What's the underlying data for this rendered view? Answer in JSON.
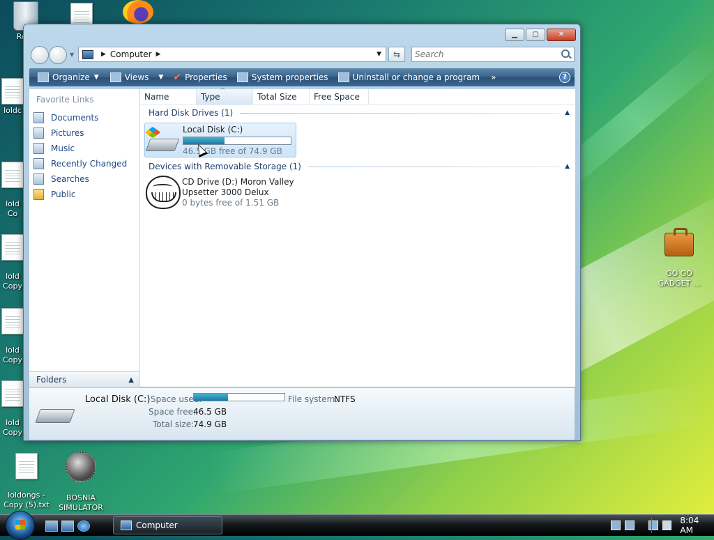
{
  "desktop": {
    "icons": [
      {
        "label": "Recy",
        "icon": "recycle-bin-icon"
      },
      {
        "label": "loldc",
        "icon": "text-file-icon"
      },
      {
        "label": "lold\nCo",
        "icon": "text-file-icon"
      },
      {
        "label": "lold\nCopy",
        "icon": "text-file-icon"
      },
      {
        "label": "lold\nCopy",
        "icon": "text-file-icon"
      },
      {
        "label": "lold\nCopy",
        "icon": "text-file-icon"
      },
      {
        "label": "loldongs -\nCopy (5).txt",
        "icon": "text-file-icon"
      },
      {
        "label": "BOSNIA\nSIMULATOR",
        "icon": "naval-mine-icon"
      },
      {
        "label": "GO GO\nGADGET ...",
        "icon": "briefcase-icon"
      }
    ]
  },
  "window": {
    "address": {
      "location": "Computer"
    },
    "search": {
      "placeholder": "Search"
    },
    "toolbar": {
      "organize": "Organize",
      "views": "Views",
      "properties": "Properties",
      "system_properties": "System properties",
      "uninstall": "Uninstall or change a program",
      "more": "»"
    },
    "sidebar": {
      "title": "Favorite Links",
      "items": [
        "Documents",
        "Pictures",
        "Music",
        "Recently Changed",
        "Searches",
        "Public"
      ],
      "folders_label": "Folders"
    },
    "columns": [
      "Name",
      "Type",
      "Total Size",
      "Free Space"
    ],
    "groups": [
      {
        "title": "Hard Disk Drives (1)",
        "items": [
          {
            "name": "Local Disk (C:)",
            "free_text": "46.5 GB free of 74.9 GB",
            "used_fraction": 0.38
          }
        ]
      },
      {
        "title": "Devices with Removable Storage (1)",
        "items": [
          {
            "name_line1": "CD Drive (D:) Moron Valley",
            "name_line2": "Upsetter 3000 Delux",
            "free_text": "0 bytes free of 1.51 GB"
          }
        ]
      }
    ],
    "details": {
      "name": "Local Disk (C:)",
      "space_used_label": "Space used:",
      "space_used_fraction": 0.38,
      "file_system_label": "File system:",
      "file_system": "NTFS",
      "space_free_label": "Space free:",
      "space_free": "46.5 GB",
      "total_size_label": "Total size:",
      "total_size": "74.9 GB"
    }
  },
  "taskbar": {
    "task_label": "Computer",
    "clock": "8:04 AM"
  }
}
